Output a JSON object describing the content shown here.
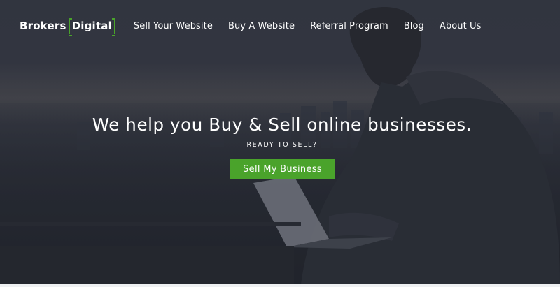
{
  "brand": {
    "name_left": "Brokers",
    "name_right": "Digital",
    "accent": "#4aa32b"
  },
  "nav": {
    "items": [
      {
        "label": "Sell Your Website"
      },
      {
        "label": "Buy A Website"
      },
      {
        "label": "Referral Program"
      },
      {
        "label": "Blog"
      },
      {
        "label": "About Us"
      }
    ]
  },
  "hero": {
    "headline": "We help you Buy & Sell online businesses.",
    "subheading": "READY TO SELL?",
    "cta_label": "Sell My Business"
  }
}
